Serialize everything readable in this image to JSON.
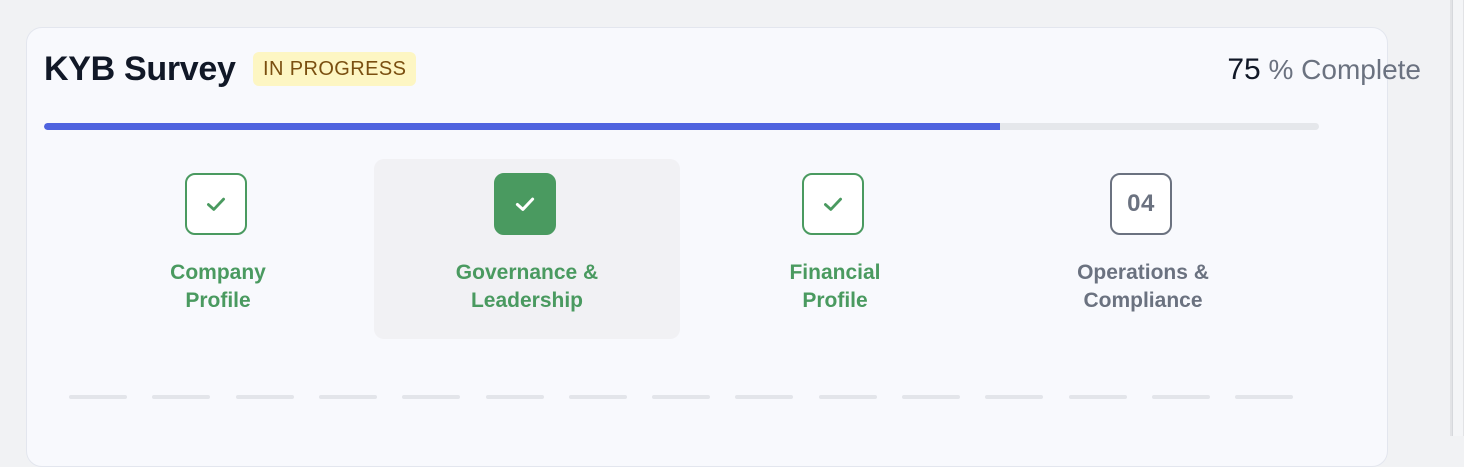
{
  "survey": {
    "title": "KYB Survey",
    "status": "IN PROGRESS",
    "progress_value": "75",
    "progress_suffix": "% Complete",
    "progress_fraction": 0.75
  },
  "steps": [
    {
      "label_line1": "Company",
      "label_line2": "Profile",
      "state": "completed",
      "icon": "check-icon"
    },
    {
      "label_line1": "Governance &",
      "label_line2": "Leadership",
      "state": "current",
      "icon": "check-icon"
    },
    {
      "label_line1": "Financial",
      "label_line2": "Profile",
      "state": "completed",
      "icon": "check-icon"
    },
    {
      "label_line1": "Operations &",
      "label_line2": "Compliance",
      "state": "pending",
      "number": "04"
    }
  ],
  "colors": {
    "accent": "#4f63df",
    "success": "#4a9a60",
    "badge_bg": "#fdf6c3",
    "badge_text": "#7a4f10",
    "muted": "#6b7280"
  }
}
